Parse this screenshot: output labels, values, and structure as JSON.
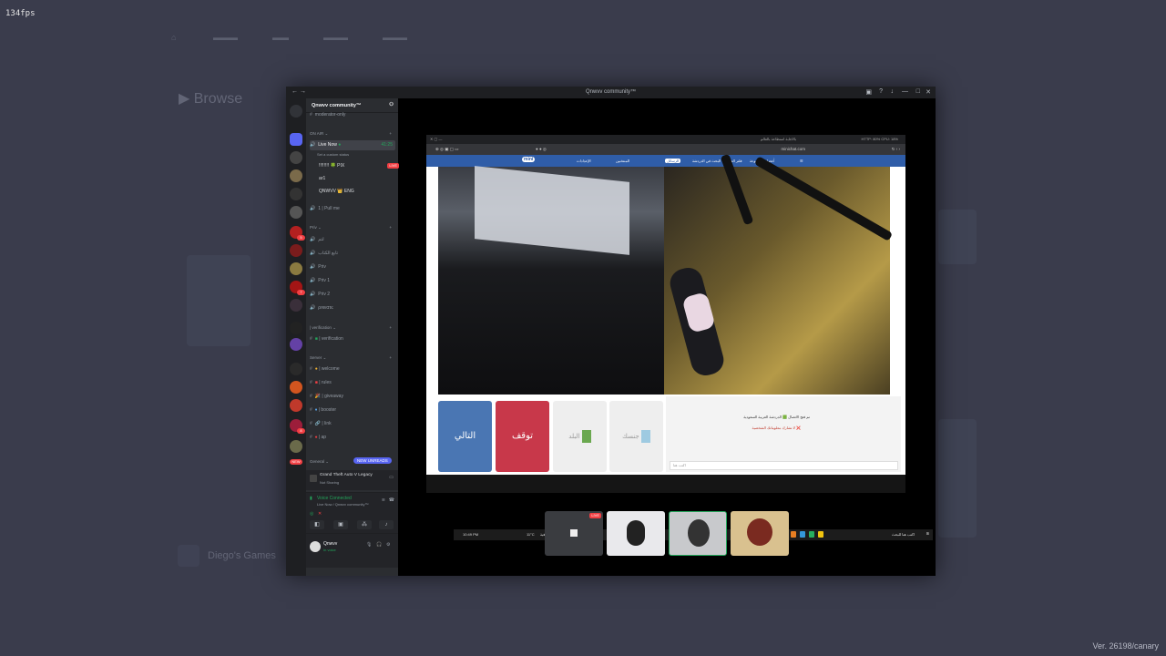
{
  "overlay": {
    "fps": "134fps",
    "version": "Ver. 26198/canary"
  },
  "background_app": {
    "heading": "Browse",
    "cards": [
      "Diego's Games"
    ]
  },
  "window": {
    "title": "Qnwvv community™",
    "server_name": "Qnwvv community™",
    "channels": {
      "top_partial": "moderator-only",
      "on_air_category": "ON AIR",
      "live_now": {
        "name": "Live Now",
        "status": "Set a custom status",
        "timer": "41:25"
      },
      "voice_members": [
        {
          "name": "!!!!!!!! 🍀 PIX",
          "badge": "LIVE"
        },
        {
          "name": "ar1"
        },
        {
          "name": "QNWVV 👑 ENG"
        }
      ],
      "pull_me": "1 | Pull me",
      "priv_category": "Priv",
      "priv_channels": [
        "لتم",
        "تابع الكتاب",
        "Priv",
        "Priv 1",
        "Priv 2",
        "ρяινατє"
      ],
      "verification_category": "| verification",
      "verification_channel": "| verification",
      "server_category": "Server",
      "server_channels": [
        "| welcome",
        "| rules",
        "| giveaway",
        "| booster",
        "| link",
        "| ap"
      ],
      "general_category": "General",
      "new_unreads": "NEW UNREADS"
    },
    "activity": {
      "game": "Grand Theft Auto V Legacy",
      "status": "Not Sharing"
    },
    "voice": {
      "status": "Voice Connected",
      "location": "Live Now / Qnwvv community™"
    },
    "user": {
      "name": "Qnwvv",
      "status": "In voice"
    },
    "server_badges": [
      "5",
      "7",
      "8",
      "NEW"
    ]
  },
  "stream": {
    "browser": {
      "url": "minichat.com",
      "tabs_text": "بالاجابة استطاعة بالعالم",
      "stats": "HTTP: 80% CPU: 18%"
    },
    "site_nav": {
      "logo": "mini",
      "items": [
        "فلاتر عامة",
        "أعضاء المجموعة",
        "فلتر العمر",
        "البحث في الدردشة",
        "الرسائل",
        "المنتخبين",
        "الإعدادات"
      ]
    },
    "controls": {
      "next": "التالي",
      "stop": "توقف",
      "country": "البلد",
      "gender": "جنسك"
    },
    "chat": {
      "line1": "تم فتح الاتصال 🟩 الدردشة العربية السعودية",
      "line2": "لا تشارك معلوماتك الشخصية ❌",
      "placeholder": "اكتب هنا"
    },
    "taskbar": {
      "time": "10:49 PM",
      "weather": "11°C",
      "weather_label": "سماء صافية",
      "search": "اكتب هنا للبحث"
    },
    "thumbnails": [
      {
        "label": "LIVE",
        "color": "#3a3c40"
      },
      {
        "label": "",
        "color": "#e9e9ec"
      },
      {
        "label": "",
        "color": "#c8c9cc"
      },
      {
        "label": "",
        "color": "#d9c18f"
      }
    ]
  }
}
